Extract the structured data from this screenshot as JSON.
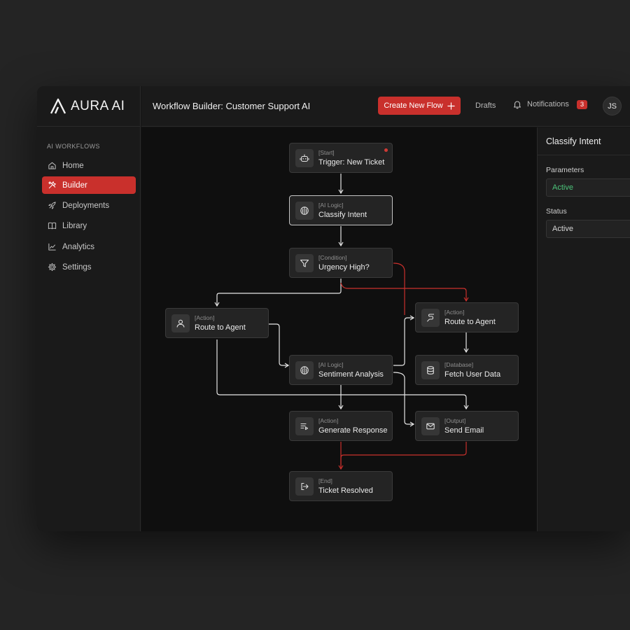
{
  "brand": {
    "name": "AURA AI"
  },
  "sidebar": {
    "heading": "AI WORKFLOWS",
    "items": [
      {
        "label": "Home",
        "icon": "home-icon"
      },
      {
        "label": "Builder",
        "icon": "tools-icon",
        "active": true
      },
      {
        "label": "Deployments",
        "icon": "rocket-icon"
      },
      {
        "label": "Library",
        "icon": "book-icon"
      },
      {
        "label": "Analytics",
        "icon": "chart-line-icon"
      },
      {
        "label": "Settings",
        "icon": "gear-icon"
      }
    ]
  },
  "header": {
    "title": "Workflow Builder: Customer Support AI",
    "create_label": "Create New Flow",
    "drafts_label": "Drafts",
    "notifications_label": "Notifications",
    "notifications_count": "3",
    "avatar_initials": "JS"
  },
  "nodes": [
    {
      "kind": "[Start]",
      "label": "Trigger: New Ticket",
      "icon": "robot-icon"
    },
    {
      "kind": "[AI Logic]",
      "label": "Classify Intent",
      "icon": "brain-icon"
    },
    {
      "kind": "[Condition]",
      "label": "Urgency High?",
      "icon": "filter-icon"
    },
    {
      "kind": "[Action]",
      "label": "Route to Agent",
      "icon": "user-icon"
    },
    {
      "kind": "[Action]",
      "label": "Route to Agent",
      "icon": "route-icon"
    },
    {
      "kind": "[AI Logic]",
      "label": "Sentiment Analysis",
      "icon": "brain-icon"
    },
    {
      "kind": "[Database]",
      "label": "Fetch User Data",
      "icon": "database-icon"
    },
    {
      "kind": "[Action]",
      "label": "Generate Response",
      "icon": "text-generate-icon"
    },
    {
      "kind": "[Output]",
      "label": "Send Email",
      "icon": "mail-icon"
    },
    {
      "kind": "[End]",
      "label": "Ticket Resolved",
      "icon": "exit-icon"
    }
  ],
  "panel": {
    "title": "Classify Intent",
    "parameters_label": "Parameters",
    "parameters_value": "Active",
    "status_label": "Status",
    "status_value": "Active"
  },
  "colors": {
    "accent": "#c9302c",
    "edge_white": "#e6e6e6",
    "edge_red": "#c9302c",
    "parameters_value": "#4cc47a"
  }
}
